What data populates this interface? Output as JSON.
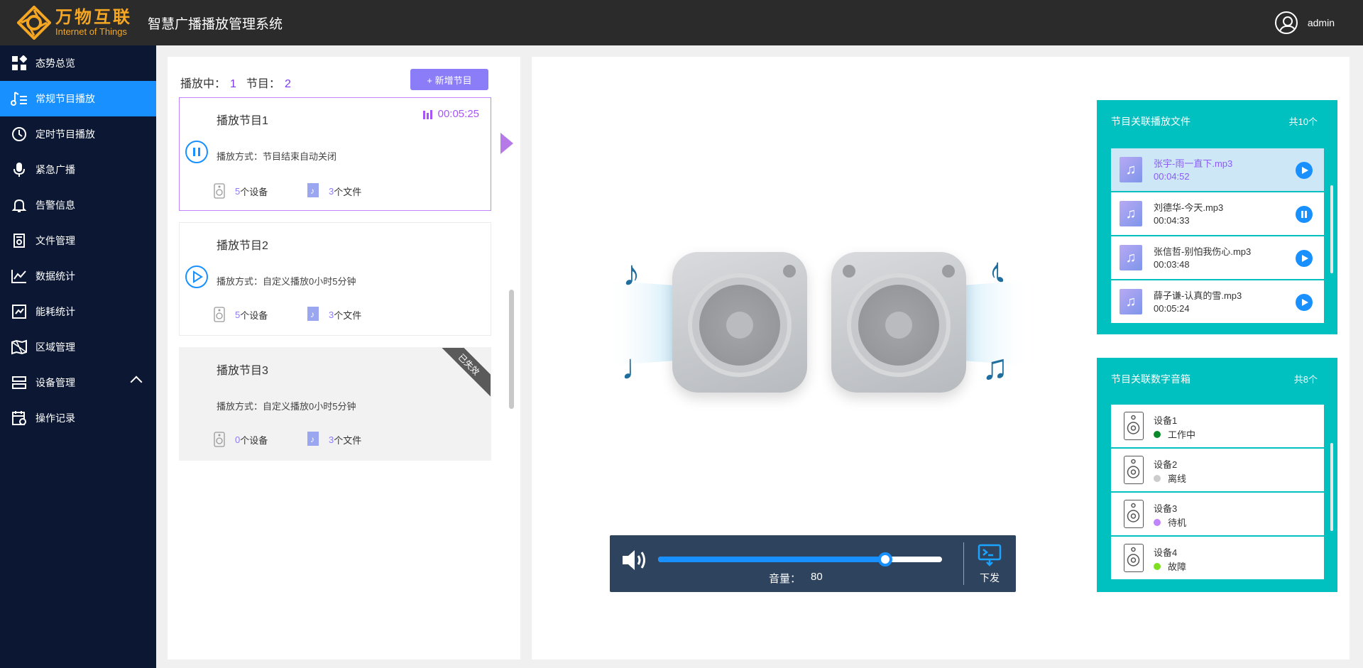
{
  "header": {
    "logo_cn": "万物互联",
    "logo_en": "Internet of Things",
    "system_title": "智慧广播播放管理系统",
    "username": "admin"
  },
  "sidebar": {
    "items": [
      {
        "label": "态势总览",
        "icon": "dashboard-icon",
        "active": false
      },
      {
        "label": "常规节目播放",
        "icon": "music-list-icon",
        "active": true
      },
      {
        "label": "定时节目播放",
        "icon": "clock-icon",
        "active": false
      },
      {
        "label": "紧急广播",
        "icon": "microphone-icon",
        "active": false
      },
      {
        "label": "告警信息",
        "icon": "bell-icon",
        "active": false
      },
      {
        "label": "文件管理",
        "icon": "file-icon",
        "active": false
      },
      {
        "label": "数据统计",
        "icon": "line-chart-icon",
        "active": false
      },
      {
        "label": "能耗统计",
        "icon": "energy-icon",
        "active": false
      },
      {
        "label": "区域管理",
        "icon": "map-icon",
        "active": false
      },
      {
        "label": "设备管理",
        "icon": "device-icon",
        "active": false
      },
      {
        "label": "操作记录",
        "icon": "calendar-log-icon",
        "active": false
      }
    ]
  },
  "programs": {
    "playing_label": "播放中：",
    "playing_count": "1",
    "total_label": "节目：",
    "total_count": "2",
    "add_button": "+ 新增节目",
    "list": [
      {
        "name": "播放节目1",
        "time": "00:05:25",
        "mode": "播放方式：节目结束自动关闭",
        "devices": "5",
        "devices_unit": "个设备",
        "files": "3",
        "files_unit": "个文件",
        "state": "playing"
      },
      {
        "name": "播放节目2",
        "time": "",
        "mode": "播放方式：自定义播放0小时5分钟",
        "devices": "5",
        "devices_unit": "个设备",
        "files": "3",
        "files_unit": "个文件",
        "state": "stopped"
      },
      {
        "name": "播放节目3",
        "time": "",
        "mode": "播放方式：自定义播放0小时5分钟",
        "devices": "0",
        "devices_unit": "个设备",
        "files": "3",
        "files_unit": "个文件",
        "state": "expired",
        "badge": "已失效"
      }
    ]
  },
  "volume": {
    "label": "音量：",
    "value": 80,
    "value_text": "80",
    "send_label": "下发"
  },
  "files_panel": {
    "title": "节目关联播放文件",
    "count_prefix": "共",
    "count": "10",
    "count_suffix": "个",
    "items": [
      {
        "name": "张宇-雨一直下.mp3",
        "duration": "00:04:52",
        "highlight": true,
        "control": "play"
      },
      {
        "name": "刘德华-今天.mp3",
        "duration": "00:04:33",
        "highlight": false,
        "control": "pause"
      },
      {
        "name": "张信哲-别怕我伤心.mp3",
        "duration": "00:03:48",
        "highlight": false,
        "control": "play"
      },
      {
        "name": "薛子谦-认真的雪.mp3",
        "duration": "00:05:24",
        "highlight": false,
        "control": "play"
      }
    ]
  },
  "devices_panel": {
    "title": "节目关联数字音箱",
    "count_prefix": "共",
    "count": "8",
    "count_suffix": "个",
    "items": [
      {
        "name": "设备1",
        "status": "工作中",
        "color": "#0a8a2a"
      },
      {
        "name": "设备2",
        "status": "离线",
        "color": "#cccccc"
      },
      {
        "name": "设备3",
        "status": "待机",
        "color": "#c084fc"
      },
      {
        "name": "设备4",
        "status": "故障",
        "color": "#7ee021"
      }
    ]
  },
  "colors": {
    "accent": "#1890ff",
    "purple": "#8b7cf7",
    "teal": "#00c0c0",
    "sidebar_bg": "#0c1833"
  }
}
